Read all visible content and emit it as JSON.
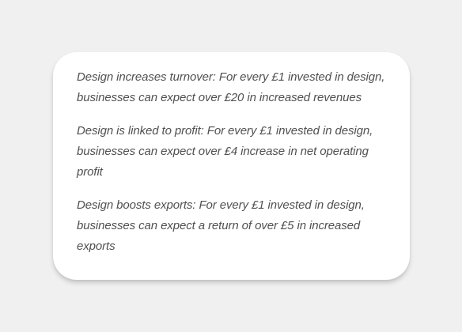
{
  "card": {
    "paragraphs": [
      "Design increases turnover: For every £1 invested in design, businesses can expect over £20 in increased revenues",
      "Design is linked to profit: For every £1 invested in design, businesses can expect over £4 increase in net operating profit",
      "Design boosts exports: For every £1 invested in design, businesses can expect a return of over £5 in increased exports"
    ]
  }
}
